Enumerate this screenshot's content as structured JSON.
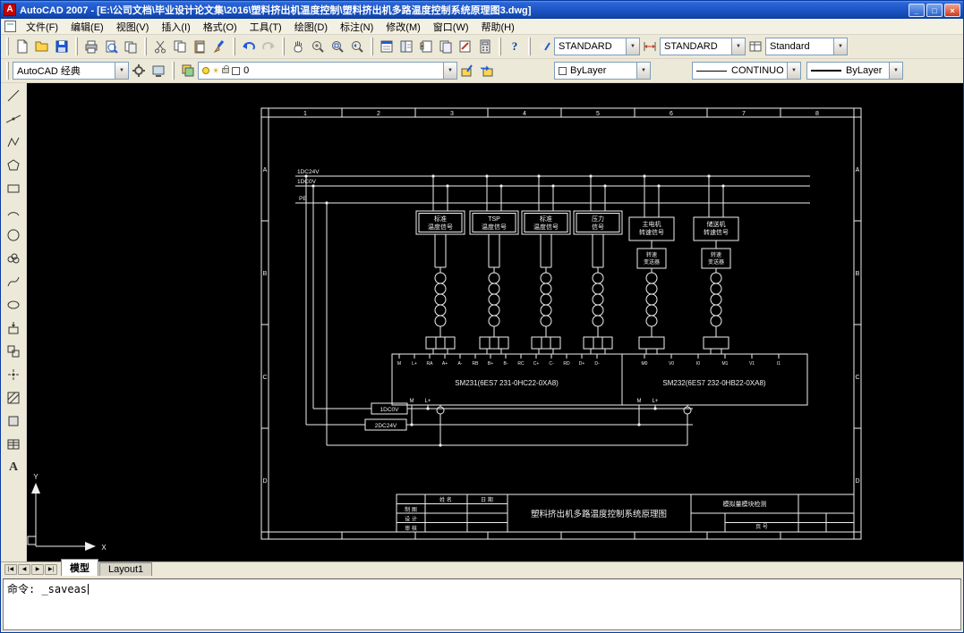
{
  "window": {
    "title": "AutoCAD 2007 - [E:\\公司文档\\毕业设计论文集\\2016\\塑料挤出机温度控制\\塑料挤出机多路温度控制系统原理图3.dwg]"
  },
  "icons": {
    "minimize": "_",
    "maximize": "□",
    "close": "×",
    "tab_first": "|◀",
    "tab_prev": "◀",
    "tab_next": "▶",
    "tab_last": "▶|",
    "help": "?"
  },
  "colors": {
    "titlebar_blue": "#1f58c8",
    "chrome_bg": "#ece9d8",
    "canvas_bg": "#000000",
    "drawing_line": "#ffffff",
    "appicon_red": "#c40000"
  },
  "menu": {
    "items": [
      "文件(F)",
      "编辑(E)",
      "视图(V)",
      "插入(I)",
      "格式(O)",
      "工具(T)",
      "绘图(D)",
      "标注(N)",
      "修改(M)",
      "窗口(W)",
      "帮助(H)"
    ]
  },
  "styles_toolbar": {
    "text_style": "STANDARD",
    "dim_style": "STANDARD",
    "table_style": "Standard"
  },
  "layers_toolbar": {
    "workspace": "AutoCAD 经典",
    "layer": "0",
    "color": "ByLayer",
    "linetype": "CONTINUOUS",
    "lineweight": "ByLayer"
  },
  "tabs": {
    "items": [
      "模型",
      "Layout1"
    ],
    "active": "模型"
  },
  "command": {
    "line1": "命令: _saveas"
  },
  "drawing": {
    "column_numbers": [
      "1",
      "2",
      "3",
      "4",
      "5",
      "6",
      "7",
      "8"
    ],
    "row_letters": [
      "A",
      "B",
      "C",
      "D"
    ],
    "bus_labels": {
      "dc24": "1DC24V",
      "dc0": "1DC0V",
      "pe": "PE"
    },
    "signal_boxes": [
      {
        "line1": "标准",
        "line2": "温度信号"
      },
      {
        "line1": "TSP",
        "line2": "温度信号"
      },
      {
        "line1": "标准",
        "line2": "温度信号"
      },
      {
        "line1": "压力",
        "line2": "信号"
      }
    ],
    "right_boxes": [
      {
        "line1": "主电机",
        "line2": "转速信号"
      },
      {
        "line1": "储送机",
        "line2": "转速信号"
      }
    ],
    "transmitters": [
      {
        "line1": "转速",
        "line2": "变送器"
      },
      {
        "line1": "转速",
        "line2": "变送器"
      }
    ],
    "sm231_label": "SM231(6ES7 231-0HC22-0XA8)",
    "sm232_label": "SM232(6ES7 232-0HB22-0XA8)",
    "sm231_terminals": [
      "M",
      "L+",
      "RA",
      "A+",
      "A-",
      "RB",
      "B+",
      "B-",
      "RC",
      "C+",
      "C-",
      "RD",
      "D+",
      "D-"
    ],
    "sm232_terminals": [
      "M0",
      "V0",
      "I0",
      "M1",
      "V1",
      "I1"
    ],
    "bottom_bus": {
      "dc0": "1DC0V",
      "dc24": "2DC24V"
    },
    "bottom_terminals": {
      "m": "M",
      "lplus": "L+"
    },
    "titleblock": {
      "name_header": "姓 名",
      "date_header": "日 期",
      "rows": [
        "制 图",
        "设 计",
        "审 核"
      ],
      "title": "塑料挤出机多路温度控制系统原理图",
      "module_note": "模拟量模块检测",
      "page_label": "页 号"
    },
    "ucs": {
      "x": "X",
      "y": "Y"
    }
  }
}
